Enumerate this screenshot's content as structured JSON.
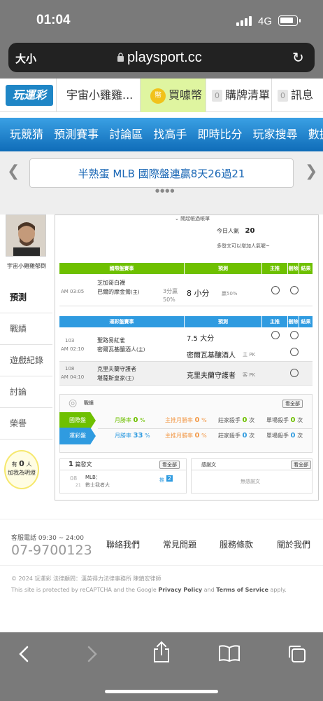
{
  "status": {
    "time": "01:04",
    "network": "4G"
  },
  "browser": {
    "text_size": "大小",
    "url": "playsport.cc"
  },
  "header": {
    "logo": "玩運彩",
    "user": "宇宙小雞雞...",
    "coin_label": "買噱幣",
    "cart_count": "0",
    "cart_label": "購牌清單",
    "msg_count": "0",
    "msg_label": "訊息"
  },
  "nav": {
    "items": [
      "玩競猜",
      "預測賽事",
      "討論區",
      "找高手",
      "即時比分",
      "玩家搜尋",
      "數據"
    ]
  },
  "banner": {
    "text": "半熟蛋 MLB 國際盤連贏8天26過21"
  },
  "sidebar": {
    "username": "宇宙小雞雞郁倒",
    "items": [
      "預測",
      "戰績",
      "遊戲紀錄",
      "討論",
      "榮譽"
    ],
    "followers_prefix": "有",
    "followers_count": "0",
    "followers_suffix": "人",
    "followers_note": "加我為明燈"
  },
  "main": {
    "toggle": "開起帳過帳單",
    "today_label": "今日人氣",
    "today_value": "20",
    "hint": "多發文可以增加人氣喔~",
    "intl": {
      "header_game": "國際盤賽事",
      "header_pred": "預測",
      "header_main": "主推",
      "header_del": "刪除",
      "header_result": "結果",
      "row": {
        "time": "AM 03:05",
        "team1": "芝加哥白襪",
        "team2": "巴爾的摩金鶯",
        "team2_mark": "(主)",
        "spread": "3分贏",
        "pct": "50%",
        "pick": "8 小分",
        "pick_note": "贏50%"
      }
    },
    "lottery": {
      "header_game": "運彩盤賽事",
      "header_pred": "預測",
      "header_main": "主推",
      "header_del": "刪除",
      "header_result": "結果",
      "rows": [
        {
          "num": "103",
          "time": "AM 02:10",
          "team1": "聖路易紅雀",
          "team2": "密爾瓦基釀酒人",
          "team2_mark": "(主)",
          "pick1": "7.5 大分",
          "pick2": "密爾瓦基釀酒人",
          "pick2_note": "主 PK"
        },
        {
          "num": "108",
          "time": "AM 04:10",
          "team1": "克里夫蘭守護者",
          "team2": "堪薩斯皇家",
          "team2_mark": "(主)",
          "pick1": "克里夫蘭守護者",
          "pick1_note": "客 PK"
        }
      ]
    },
    "record": {
      "title": "戰績",
      "view_all": "看全部",
      "intl_label": "國際盤",
      "lottery_label": "運彩盤",
      "month_win": "月勝率",
      "main_month_win": "主推月勝率",
      "home_hit": "莊家殺手",
      "single_hit": "單場殺手",
      "unit": "次",
      "intl": {
        "month_win": "0",
        "main_month_win": "0",
        "home_hit": "0",
        "single_hit": "0"
      },
      "lottery": {
        "month_win": "33",
        "main_month_win": "0",
        "home_hit": "0",
        "single_hit": "0"
      },
      "pct": "%"
    },
    "posts": {
      "count": "1",
      "label": "篇發文",
      "view_all": "看全部",
      "item_month": "08",
      "item_day": "21",
      "item_title": "MLB：",
      "item_sub": "數士我者大",
      "item_tag": "推",
      "item_push": "2"
    },
    "thanks": {
      "label": "感謝文",
      "view_all": "看全部",
      "empty": "無感謝文"
    }
  },
  "footer": {
    "service_hours": "客服電話 09:30 ~ 24:00",
    "phone": "07-9700123",
    "links": [
      "聯絡我們",
      "常見問題",
      "服務條款",
      "關於我們"
    ],
    "copyright": "© 2024 玩運彩 法律顧問：漢英得力法律事務所 陳鎮宏律師",
    "captcha_prefix": "This site is protected by reCAPTCHA and the Google",
    "privacy": "Privacy Policy",
    "and": "and",
    "terms": "Terms of Service",
    "apply": "apply."
  }
}
